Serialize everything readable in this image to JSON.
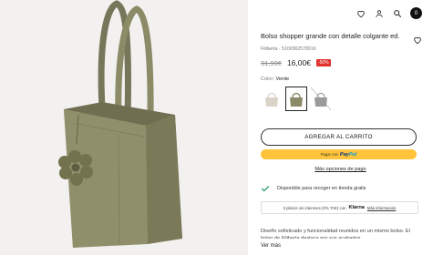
{
  "header": {
    "icons": [
      "heart-icon",
      "user-icon",
      "search-icon",
      "cart-icon"
    ],
    "cart_count": "0"
  },
  "product": {
    "title": "Bolso shopper grande con detalle colgante ed.",
    "sku": "Filiberta · 5100362578016",
    "old_price": "31,99€",
    "new_price": "16,00€",
    "discount": "-50%",
    "color_label": "Color:",
    "color_value": "Verde"
  },
  "swatches": [
    {
      "name": "beige",
      "color": "#d9d3c8",
      "selected": false
    },
    {
      "name": "verde",
      "color": "#8c8b68",
      "selected": true
    },
    {
      "name": "gris",
      "color": "#9a9a9a",
      "selected": false
    }
  ],
  "actions": {
    "add_to_cart": "AGREGAR AL CARRITO",
    "paypal_pre": "Pagar con",
    "paypal_logo_a": "Pay",
    "paypal_logo_b": "Pal",
    "more_payment": "Más opciones de pago"
  },
  "pickup": {
    "text": "Disponible para recoger en tienda gratis"
  },
  "klarna": {
    "text": "3 plazos sin intereses (0% TAE) con",
    "logo": "Klarna",
    "link": "Más información"
  },
  "description": {
    "text": "Diseño sofisticado y funcionalidad reunidos en un mismo bolso. El bolso de Filiberta destaca por sus acabados",
    "more": "Ver más"
  },
  "colors": {
    "bag": "#8c8b68",
    "discount": "#e0312c",
    "paypal_bg": "#ffc439",
    "check": "#2a9d6a"
  }
}
